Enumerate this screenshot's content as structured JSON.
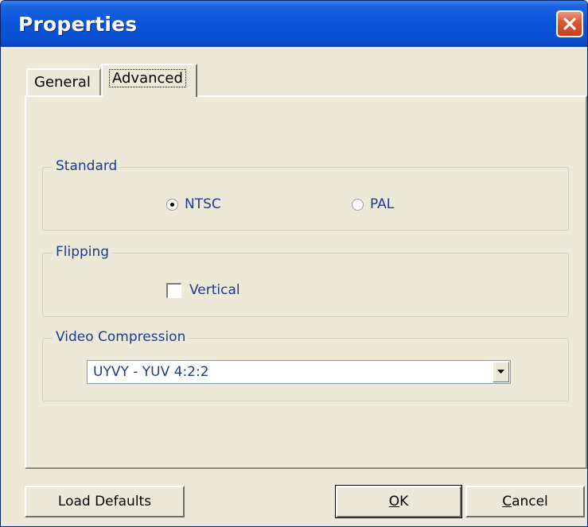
{
  "window": {
    "title": "Properties",
    "close_icon": "close-icon"
  },
  "tabs": [
    {
      "label": "General",
      "selected": false
    },
    {
      "label": "Advanced",
      "selected": true
    }
  ],
  "standard": {
    "legend": "Standard",
    "options": [
      {
        "label": "NTSC",
        "checked": true
      },
      {
        "label": "PAL",
        "checked": false
      }
    ]
  },
  "flipping": {
    "legend": "Flipping",
    "vertical_label": "Vertical",
    "vertical_checked": false
  },
  "video_compression": {
    "legend": "Video Compression",
    "selected": "UYVY - YUV 4:2:2",
    "dropdown_icon": "chevron-down-icon"
  },
  "buttons": {
    "load_defaults": "Load Defaults",
    "ok": "OK",
    "ok_accel": "O",
    "ok_rest": "K",
    "cancel": "Cancel",
    "cancel_accel": "C",
    "cancel_rest": "ancel"
  },
  "colors": {
    "titlebar": "#0A54DA",
    "dialog_bg": "#ECE9D8",
    "label_text": "#1F3A93",
    "close_button": "#DA5B36"
  }
}
